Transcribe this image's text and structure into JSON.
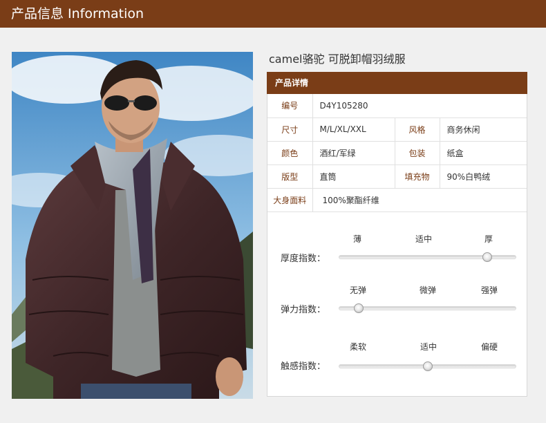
{
  "header": {
    "title": "产品信息 Information"
  },
  "product": {
    "name": "camel骆驼 可脱卸帽羽绒服"
  },
  "details": {
    "title": "产品详情",
    "rows": [
      [
        {
          "k": "编号",
          "v": "D4Y105280"
        }
      ],
      [
        {
          "k": "尺寸",
          "v": "M/L/XL/XXL"
        },
        {
          "k": "风格",
          "v": "商务休闲"
        }
      ],
      [
        {
          "k": "颜色",
          "v": "酒红/军绿"
        },
        {
          "k": "包装",
          "v": "纸盒"
        }
      ],
      [
        {
          "k": "版型",
          "v": "直筒"
        },
        {
          "k": "填充物",
          "v": "90%白鸭绒"
        }
      ],
      [
        {
          "k": "大身面料",
          "v": "100%聚酯纤维"
        }
      ]
    ]
  },
  "indices": [
    {
      "label": "厚度指数：",
      "ticks": [
        "薄",
        "适中",
        "厚"
      ],
      "level": 0.84
    },
    {
      "label": "弹力指数：",
      "ticks": [
        "无弹",
        "微弹",
        "强弹"
      ],
      "level": 0.11
    },
    {
      "label": "触感指数：",
      "ticks": [
        "柔软",
        "适中",
        "偏硬"
      ],
      "level": 0.5
    }
  ],
  "colors": {
    "brand": "#7a3d17",
    "background": "#f0f0f0"
  },
  "photo": {
    "subject": "man-in-puffer-jacket-photo"
  }
}
